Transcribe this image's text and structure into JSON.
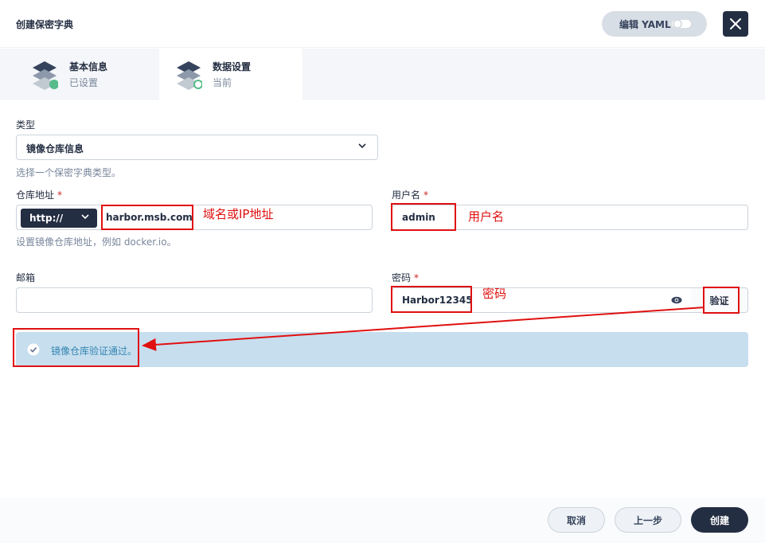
{
  "header": {
    "title": "创建保密字典",
    "yaml_label": "编辑 YAML"
  },
  "steps": [
    {
      "title": "基本信息",
      "status": "已设置"
    },
    {
      "title": "数据设置",
      "status": "当前"
    }
  ],
  "form": {
    "type": {
      "label": "类型",
      "value": "镜像仓库信息",
      "hint": "选择一个保密字典类型。"
    },
    "registry": {
      "label": "仓库地址",
      "required": "*",
      "protocol": "http://",
      "value": "harbor.msb.com",
      "hint": "设置镜像仓库地址，例如 docker.io。"
    },
    "username": {
      "label": "用户名",
      "required": "*",
      "value": "admin"
    },
    "email": {
      "label": "邮箱",
      "value": ""
    },
    "password": {
      "label": "密码",
      "required": "*",
      "value": "Harbor12345",
      "verify_label": "验证"
    },
    "alert": {
      "text": "镜像仓库验证通过。"
    }
  },
  "annotations": {
    "domain_note": "域名或IP地址",
    "username_note": "用户名",
    "password_note": "密码",
    "color": "#e01010"
  },
  "footer": {
    "cancel_label": "取消",
    "prev_label": "上一步",
    "create_label": "创建"
  },
  "colors": {
    "primary_dark": "#242e42",
    "success": "#55bc8a",
    "alert_bg": "#c7deef",
    "alert_text": "#3385b0"
  }
}
